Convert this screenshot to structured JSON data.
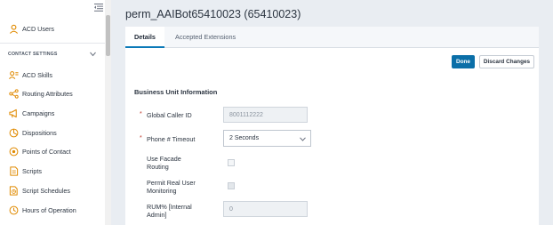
{
  "sidebar": {
    "top_item": {
      "label": "ACD Users",
      "icon": "user-icon"
    },
    "section": {
      "label": "CONTACT SETTINGS",
      "icon": "chevron-down-icon"
    },
    "items": [
      {
        "label": "ACD Skills",
        "icon": "skill-icon"
      },
      {
        "label": "Routing Attributes",
        "icon": "routing-icon"
      },
      {
        "label": "Campaigns",
        "icon": "campaign-icon"
      },
      {
        "label": "Dispositions",
        "icon": "disposition-icon"
      },
      {
        "label": "Points of Contact",
        "icon": "contact-point-icon"
      },
      {
        "label": "Scripts",
        "icon": "script-icon"
      },
      {
        "label": "Script Schedules",
        "icon": "schedule-icon"
      },
      {
        "label": "Hours of Operation",
        "icon": "clock-icon"
      }
    ],
    "accent_color": "#e08a00"
  },
  "header": {
    "title": "perm_AAIBot65410023 (65410023)"
  },
  "tabs": [
    {
      "label": "Details",
      "active": true
    },
    {
      "label": "Accepted Extensions",
      "active": false
    }
  ],
  "toolbar": {
    "done_label": "Done",
    "discard_label": "Discard Changes",
    "primary_color": "#0b6fa8"
  },
  "form": {
    "section_title": "Business Unit Information",
    "global_caller_id": {
      "label": "Global Caller ID",
      "value": "8001112222",
      "required": "*"
    },
    "phone_timeout": {
      "label": "Phone # Timeout",
      "value": "2 Seconds",
      "required": "*"
    },
    "use_facade_routing": {
      "label_line1": "Use Facade",
      "label_line2": "Routing",
      "checked": false
    },
    "permit_real_user_monitoring": {
      "label_line1": "Permit Real User",
      "label_line2": "Monitoring",
      "checked": false
    },
    "rum_percent": {
      "label_line1": "RUM% [Internal",
      "label_line2": "Admin]",
      "value": "0"
    }
  }
}
